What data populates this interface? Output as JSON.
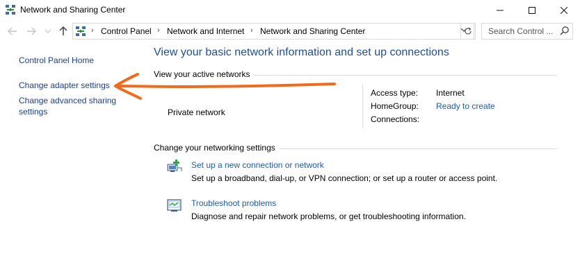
{
  "window": {
    "title": "Network and Sharing Center",
    "controls": {
      "minimize": "—",
      "maximize": "☐",
      "close": "✕"
    }
  },
  "nav": {
    "back_icon": "back-arrow-icon",
    "forward_icon": "forward-arrow-icon",
    "up_icon": "up-arrow-icon",
    "breadcrumbs": [
      "Control Panel",
      "Network and Internet",
      "Network and Sharing Center"
    ],
    "search_placeholder": "Search Control ..."
  },
  "sidebar": {
    "items": [
      {
        "label": "Control Panel Home"
      },
      {
        "label": "Change adapter settings"
      },
      {
        "label": "Change advanced sharing settings",
        "line1": "Change advanced sharing",
        "line2": "settings"
      }
    ]
  },
  "main": {
    "title": "View your basic network information and set up connections",
    "active_networks_header": "View your active networks",
    "network_name": "Private network",
    "properties": [
      {
        "label": "Access type:",
        "value": "Internet"
      },
      {
        "label": "HomeGroup:",
        "value": "Ready to create"
      },
      {
        "label": "Connections:",
        "value": ""
      }
    ],
    "change_settings_header": "Change your networking settings",
    "tasks": [
      {
        "link": "Set up a new connection or network",
        "description": "Set up a broadband, dial-up, or VPN connection; or set up a router or access point.",
        "icon": "new-connection-icon"
      },
      {
        "link": "Troubleshoot problems",
        "description": "Diagnose and repair network problems, or get troubleshooting information.",
        "icon": "troubleshoot-icon"
      }
    ]
  },
  "colors": {
    "link": "#1a5ab8",
    "title": "#1e4e9b",
    "annotation_arrow": "#f26b1d"
  }
}
